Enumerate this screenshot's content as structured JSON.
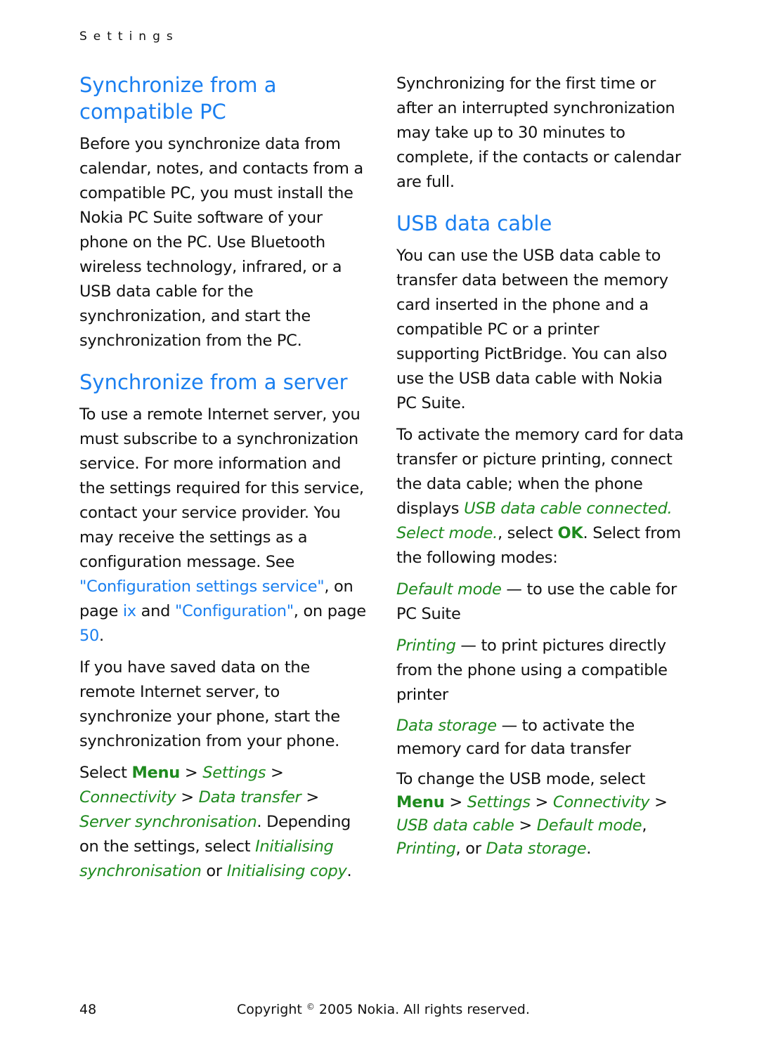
{
  "header": {
    "running_head": "Settings"
  },
  "left": {
    "h1": "Synchronize from a compatible PC",
    "p1": "Before you synchronize data from calendar, notes, and contacts from a compatible PC, you must install the Nokia PC Suite software of your phone on the PC. Use Bluetooth wireless technology, infrared, or a USB data cable for the synchronization, and start the synchronization from the PC.",
    "h2": "Synchronize from a server",
    "p2_text": "To use a remote Internet server, you must subscribe to a synchronization service. For more information and the settings required for this service, contact your service provider. You may receive the settings as a configuration message. See ",
    "p2_link1": "\"Configuration settings service\"",
    "p2_mid1": ", on page ",
    "p2_link2": "ix",
    "p2_mid2": " and ",
    "p2_link3": "\"Configuration\"",
    "p2_mid3": ", on page ",
    "p2_link4": "50",
    "p2_end": ".",
    "p3": "If you have saved data on the remote Internet server, to synchronize your phone, start the synchronization from your phone.",
    "p4": {
      "select": "Select ",
      "menu": "Menu",
      "sep": " > ",
      "settings": "Settings",
      "connectivity": "Connectivity",
      "data_transfer": "Data transfer",
      "server_sync": "Server synchronisation",
      "depending": ". Depending on the settings, select ",
      "init_sync": "Initialising synchronisation",
      "or": " or ",
      "init_copy": "Initialising copy",
      "end": "."
    }
  },
  "right": {
    "p1": "Synchronizing for the first time or after an interrupted synchronization may take up to 30 minutes to complete, if the contacts or calendar are full.",
    "h1": "USB data cable",
    "p2": "You can use the USB data cable to transfer data between the memory card inserted in the phone and a compatible PC or a printer supporting PictBridge. You can also use the USB data cable with Nokia PC Suite.",
    "p3": {
      "a": "To activate the memory card for data transfer or picture printing, connect the data cable; when the phone displays ",
      "msg": "USB data cable connected. Select mode.",
      "b": ", select ",
      "ok": "OK",
      "c": ". Select from the following modes:"
    },
    "modes": [
      {
        "name": "Default mode",
        "desc": " — to use the cable for PC Suite"
      },
      {
        "name": "Printing",
        "desc": " — to print pictures directly from the phone using a compatible printer"
      },
      {
        "name": "Data storage",
        "desc": " — to activate the memory card for data transfer"
      }
    ],
    "p4": {
      "a": "To change the USB mode, select ",
      "menu": "Menu",
      "sep": " > ",
      "settings": "Settings",
      "connectivity": "Connectivity",
      "usb": "USB data cable",
      "default": "Default mode",
      "comma": ", ",
      "printing": "Printing",
      "or": ", or ",
      "storage": "Data storage",
      "end": "."
    }
  },
  "footer": {
    "page_number": "48",
    "copyright_a": "Copyright ",
    "copyright_sym": "©",
    "copyright_b": " 2005 Nokia. All rights reserved."
  },
  "colors": {
    "heading_link": "#1a7ff0",
    "ui_term": "#1e8a1e"
  }
}
